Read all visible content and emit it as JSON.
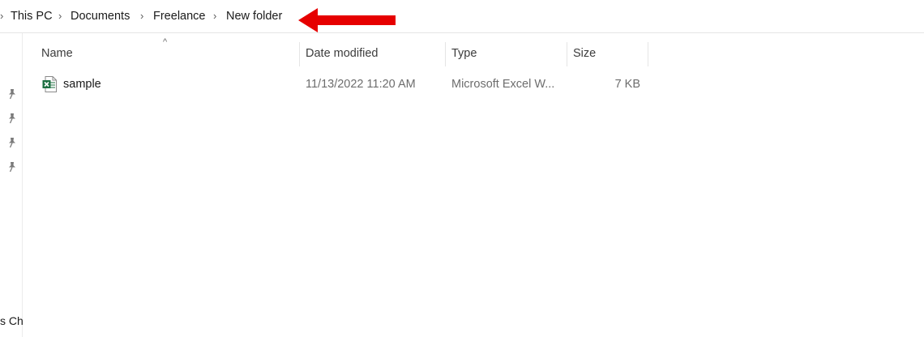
{
  "breadcrumb": {
    "items": [
      "This PC",
      "Documents",
      "Freelance",
      "New folder"
    ]
  },
  "nav_pane": {
    "partial_label": "s Ch"
  },
  "columns": {
    "name": "Name",
    "date_modified": "Date modified",
    "type": "Type",
    "size": "Size"
  },
  "files": [
    {
      "name": "sample",
      "date_modified": "11/13/2022 11:20 AM",
      "type": "Microsoft Excel W...",
      "size": "7 KB",
      "icon": "excel-file-icon"
    }
  ],
  "colors": {
    "annotation_arrow": "#e60000",
    "excel_green": "#1d6f42"
  }
}
